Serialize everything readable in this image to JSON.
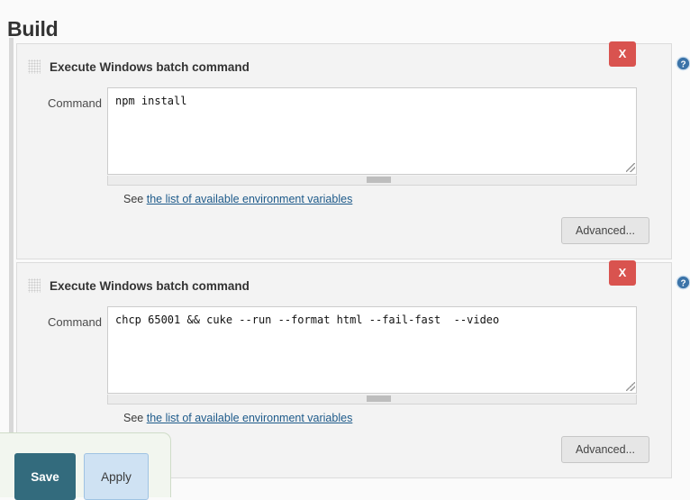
{
  "page": {
    "title": "Build"
  },
  "blocks": [
    {
      "title": "Execute Windows batch command",
      "delete_label": "X",
      "help_icon": "help-circle-icon",
      "field_label": "Command",
      "command_value": "npm install",
      "help_prefix": "See ",
      "help_link": "the list of available environment variables",
      "advanced_label": "Advanced..."
    },
    {
      "title": "Execute Windows batch command",
      "delete_label": "X",
      "help_icon": "help-circle-icon",
      "field_label": "Command",
      "command_value": "chcp 65001 && cuke --run --format html --fail-fast  --video",
      "help_prefix": "See ",
      "help_link": "the list of available environment variables",
      "advanced_label": "Advanced..."
    }
  ],
  "footer": {
    "save_label": "Save",
    "apply_label": "Apply"
  },
  "colors": {
    "delete_red": "#d9534f",
    "save_teal": "#336b7d",
    "apply_blue": "#cfe2f3",
    "link_blue": "#1d5a8a",
    "panel_bg": "#f3f3f3",
    "page_bg": "#fafafa"
  }
}
